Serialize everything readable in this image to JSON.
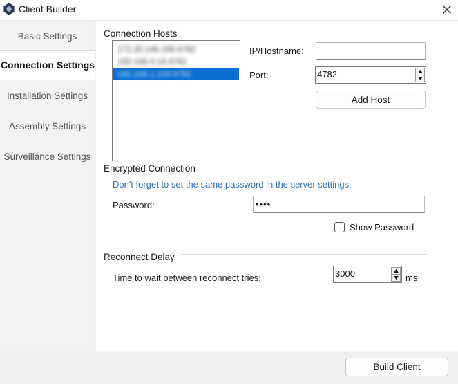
{
  "window": {
    "title": "Client Builder",
    "icon": "app-hexagon-icon",
    "close_icon": "close-icon"
  },
  "sidebar": {
    "items": [
      {
        "label": "Basic Settings",
        "active": false
      },
      {
        "label": "Connection Settings",
        "active": true
      },
      {
        "label": "Installation Settings",
        "active": false
      },
      {
        "label": "Assembly Settings",
        "active": false
      },
      {
        "label": "Surveillance Settings",
        "active": false
      }
    ]
  },
  "connection_hosts": {
    "title": "Connection Hosts",
    "hosts": [
      "172.20.145.155:4782",
      "192.168.0.14:4782",
      "192.168.1.100:4782"
    ],
    "selected_index": 2,
    "ip_label": "IP/Hostname:",
    "ip_value": "",
    "port_label": "Port:",
    "port_value": "4782",
    "add_host_label": "Add Host"
  },
  "encrypted_connection": {
    "title": "Encrypted Connection",
    "hint": "Don't forget to set the same password in the server settings.",
    "password_label": "Password:",
    "password_value": "••••",
    "show_password_label": "Show Password",
    "show_password_checked": false
  },
  "reconnect_delay": {
    "title": "Reconnect Delay",
    "label": "Time to wait between reconnect tries:",
    "value": "3000",
    "unit": "ms"
  },
  "footer": {
    "build_label": "Build Client"
  },
  "colors": {
    "accent": "#0a6ed1",
    "hint_text": "#2d6db5"
  }
}
